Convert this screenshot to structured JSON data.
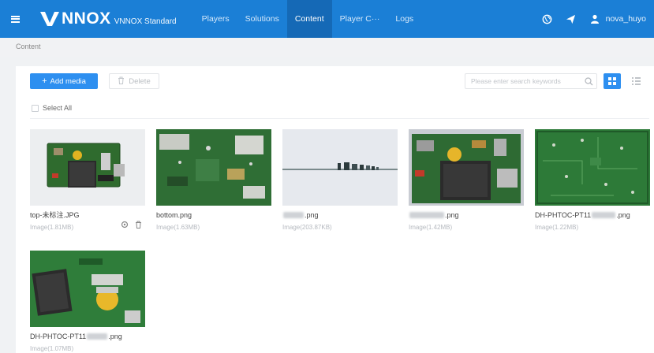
{
  "header": {
    "logo_text": "NNOX",
    "logo_sub": "VNNOX Standard",
    "nav": [
      {
        "label": "Players",
        "active": false
      },
      {
        "label": "Solutions",
        "active": false
      },
      {
        "label": "Content",
        "active": true
      },
      {
        "label": "Player C···",
        "active": false
      },
      {
        "label": "Logs",
        "active": false
      }
    ],
    "user_name": "nova_huyo",
    "icons": [
      "menu-icon",
      "globe-icon",
      "send-icon",
      "user-icon"
    ]
  },
  "breadcrumb": "Content",
  "toolbar": {
    "add_label": "Add media",
    "delete_label": "Delete",
    "search_placeholder": "Please enter search keywords",
    "select_all_label": "Select All"
  },
  "colors": {
    "header_bg": "#1b7fd6",
    "nav_active_bg": "#1569b6",
    "primary": "#2d8ff0"
  },
  "media": [
    {
      "name_prefix": "top-未标注.JPG",
      "name_suffix": "",
      "meta": "Image(1.81MB)",
      "thumb": "pcb-white"
    },
    {
      "name_prefix": "bottom.png",
      "name_suffix": "",
      "meta": "Image(1.63MB)",
      "thumb": "pcb-green"
    },
    {
      "name_prefix": "",
      "name_suffix": ".png",
      "meta": "Image(203.87KB)",
      "thumb": "strip"
    },
    {
      "name_prefix": "",
      "name_suffix": ".png",
      "meta": "Image(1.42MB)",
      "thumb": "pcb-heatsink"
    },
    {
      "name_prefix": "DH-PHTOC-PT11",
      "name_suffix": ".png",
      "meta": "Image(1.22MB)",
      "thumb": "pcb-bare"
    },
    {
      "name_prefix": "DH-PHTOC-PT11",
      "name_suffix": ".png",
      "meta": "Image(1.07MB)",
      "thumb": "pcb-coin"
    }
  ]
}
